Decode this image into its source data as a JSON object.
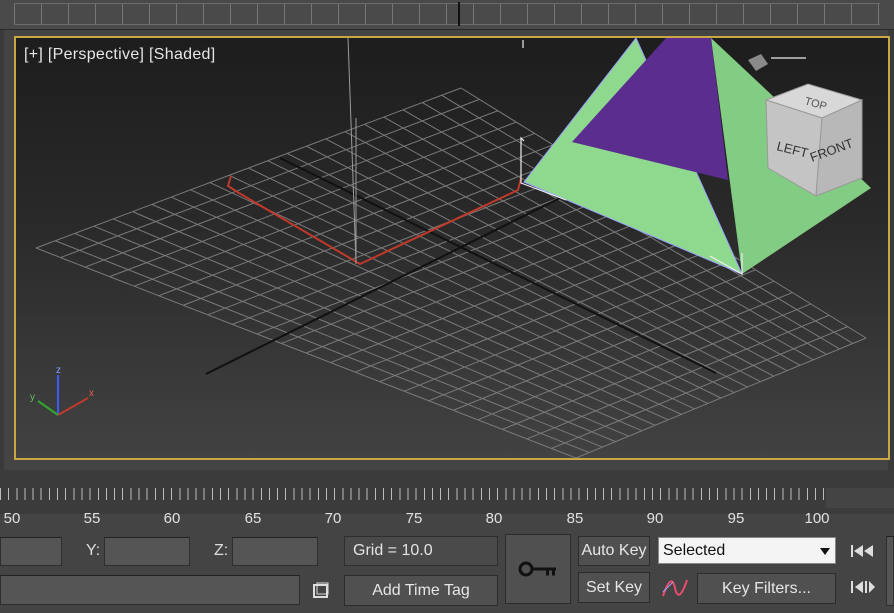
{
  "viewport": {
    "label_plus": "[+]",
    "label_view": "[Perspective]",
    "label_shading": "[Shaded]",
    "viewcube": {
      "top": "TOP",
      "left": "LEFT",
      "front": "FRONT"
    },
    "axis_tripod": {
      "z": "z",
      "x": "x",
      "y": "y"
    },
    "colors": {
      "pyramid_side": "#8fd98f",
      "pyramid_face": "#5b2d8e",
      "selection_border": "#c9a742",
      "grid": "#777777",
      "red_line": "#c0392b"
    }
  },
  "timeline": {
    "frame_labels": [
      "50",
      "55",
      "60",
      "65",
      "70",
      "75",
      "80",
      "85",
      "90",
      "95",
      "100"
    ]
  },
  "status": {
    "y_label": "Y:",
    "z_label": "Z:",
    "grid_text": "Grid = 10.0",
    "add_time_tag": "Add Time Tag",
    "auto_key": "Auto Key",
    "set_key": "Set Key",
    "selected_value": "Selected",
    "key_filters": "Key Filters...",
    "icons": [
      "key-icon",
      "curve-icon",
      "go-to-start-icon",
      "prev-frame-icon",
      "isolate-icon"
    ]
  }
}
